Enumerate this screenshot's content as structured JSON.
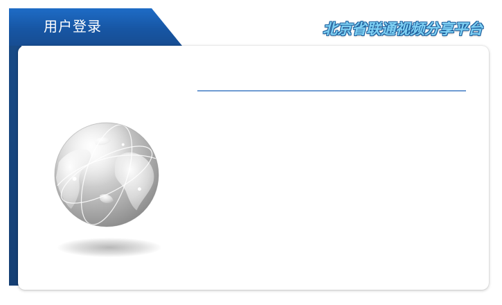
{
  "login_tab": {
    "title": "用户登录"
  },
  "brand": {
    "title": "北京省联通视频分享平台"
  },
  "colors": {
    "tab_blue": "#1a5fb0",
    "left_bar": "#17457f",
    "divider": "#6f9bd2",
    "brand_text": "#7fd0f3"
  },
  "icons": {
    "globe": "globe-icon"
  }
}
